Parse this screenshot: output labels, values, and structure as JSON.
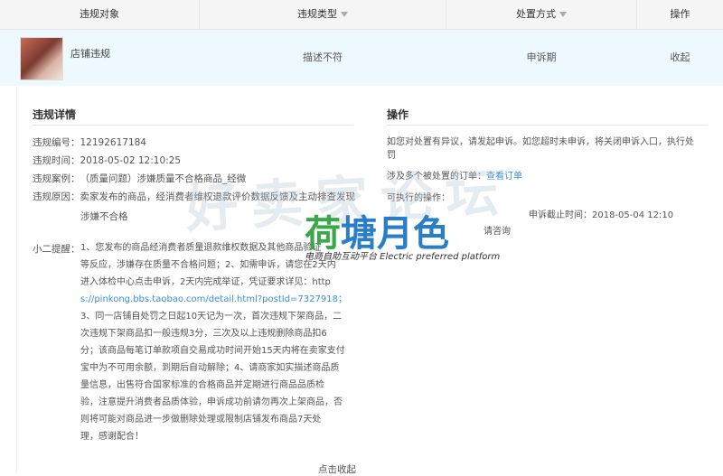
{
  "header": {
    "col_target": "违规对象",
    "col_type": "违规类型",
    "col_action": "处置方式",
    "col_ops": "操作"
  },
  "record": {
    "target_label": "店铺违规",
    "violation_type": "描述不符",
    "action": "申诉期",
    "op_link": "收起"
  },
  "detail": {
    "title": "违规详情",
    "id_label": "违规编号：",
    "id_value": "12192617184",
    "time_label": "违规时间：",
    "time_value": "2018-05-02 12:10:25",
    "case_label": "违规案例：",
    "case_value": "（质量问题）涉嫌质量不合格商品_经微",
    "reason_label": "违规原因：",
    "reason_line1": "卖家发布的商品，经消费者维权退款评价数据反馈及主动排查发现",
    "reason_line2": "涉嫌不合格",
    "tip_label": "小二提醒：",
    "tip_lines": [
      "1、您发布的商品经消费者质量退款维权数据及其他商品验证",
      "等反应，涉嫌存在质量不合格问题；2、如需申诉，请您在2天内",
      "进入体检中心点击申诉，2天内完成举证，凭证要求详见：http",
      "s://pinkong.bbs.taobao.com/detail.html?postId=7327918；",
      "3、同一店铺自处罚之日起10天记为一次，首次违规下架商品，二",
      "次违规下架商品扣一般违规3分，三次及以上违规删除商品扣6",
      "分；该商品每笔订单款项自交易成功时间开始15天内将在卖家支付",
      "宝中为不可用余额，到期后自动解除；4、请商家如实描述商品质",
      "量信息，出售符合国家标准的合格商品并定期进行商品品质检",
      "验，注意提升消费者品质体验，申诉成功前请勿再次上架商品，否",
      "则将可能对商品进一步做删除处理或限制店铺发布商品7天处",
      "理，感谢配合！"
    ],
    "collapse_link": "点击收起"
  },
  "ops": {
    "title": "操作",
    "line1": "如您对处置有异议，请发起申诉。如您超时未申诉，将关闭申诉入口，执行处",
    "line2": "罚",
    "orders_label": "涉及多个被处置的订单：",
    "orders_link": "查看订单",
    "executable_label": "可执行的操作：",
    "appeal_deadline": "申诉截止时间：2018-05-04 12:10",
    "consult_link": "请咨询"
  },
  "watermark": {
    "big": "好卖家论坛",
    "brand_green": "荷",
    "brand_blue": "塘月色",
    "tagline": "电商自助互动平台 Electric preferred platform"
  },
  "colors": {
    "link": "#3a8fd9",
    "row_highlight": "#eef8ff",
    "header_bg": "#f5f5f5"
  }
}
